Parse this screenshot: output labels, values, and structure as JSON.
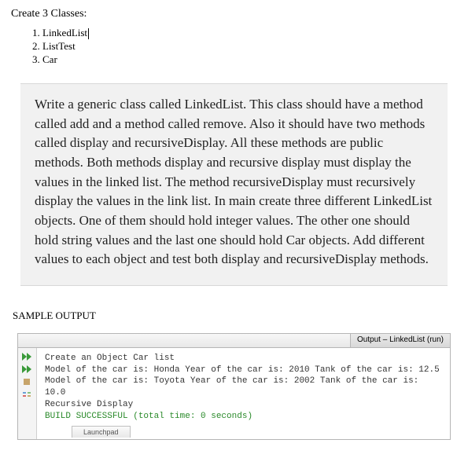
{
  "heading": "Create 3 Classes:",
  "classes": [
    "LinkedList",
    "ListTest",
    "Car"
  ],
  "instructions": "Write a generic class called LinkedList. This class should have a method called add and a method called remove. Also it should have two methods called display and recursiveDisplay. All these methods are public methods. Both methods display and recursive display must display the values in the linked list. The method recursiveDisplay must recursively display the values in the link list. In main create three different LinkedList objects. One of them should hold integer values. The other one should hold string values and the last one should hold Car objects.  Add different values to each object and test both display and recursiveDisplay methods.",
  "sample_label": "SAMPLE OUTPUT",
  "output": {
    "tab_label": "Output – LinkedList (run)",
    "lines": [
      "Create an Object Car list",
      "Model of the car is: Honda Year of the car is: 2010 Tank of the car is: 12.5",
      "Model of the car is: Toyota Year of the car is: 2002 Tank of the car is: 10.0",
      "Recursive Display"
    ],
    "build_line": "BUILD SUCCESSFUL (total time: 0 seconds)",
    "sub_tab": "Launchpad"
  },
  "icons": {
    "run1": "double-play-icon",
    "run2": "double-play-icon",
    "stop": "stop-icon",
    "settings": "settings-icon"
  }
}
